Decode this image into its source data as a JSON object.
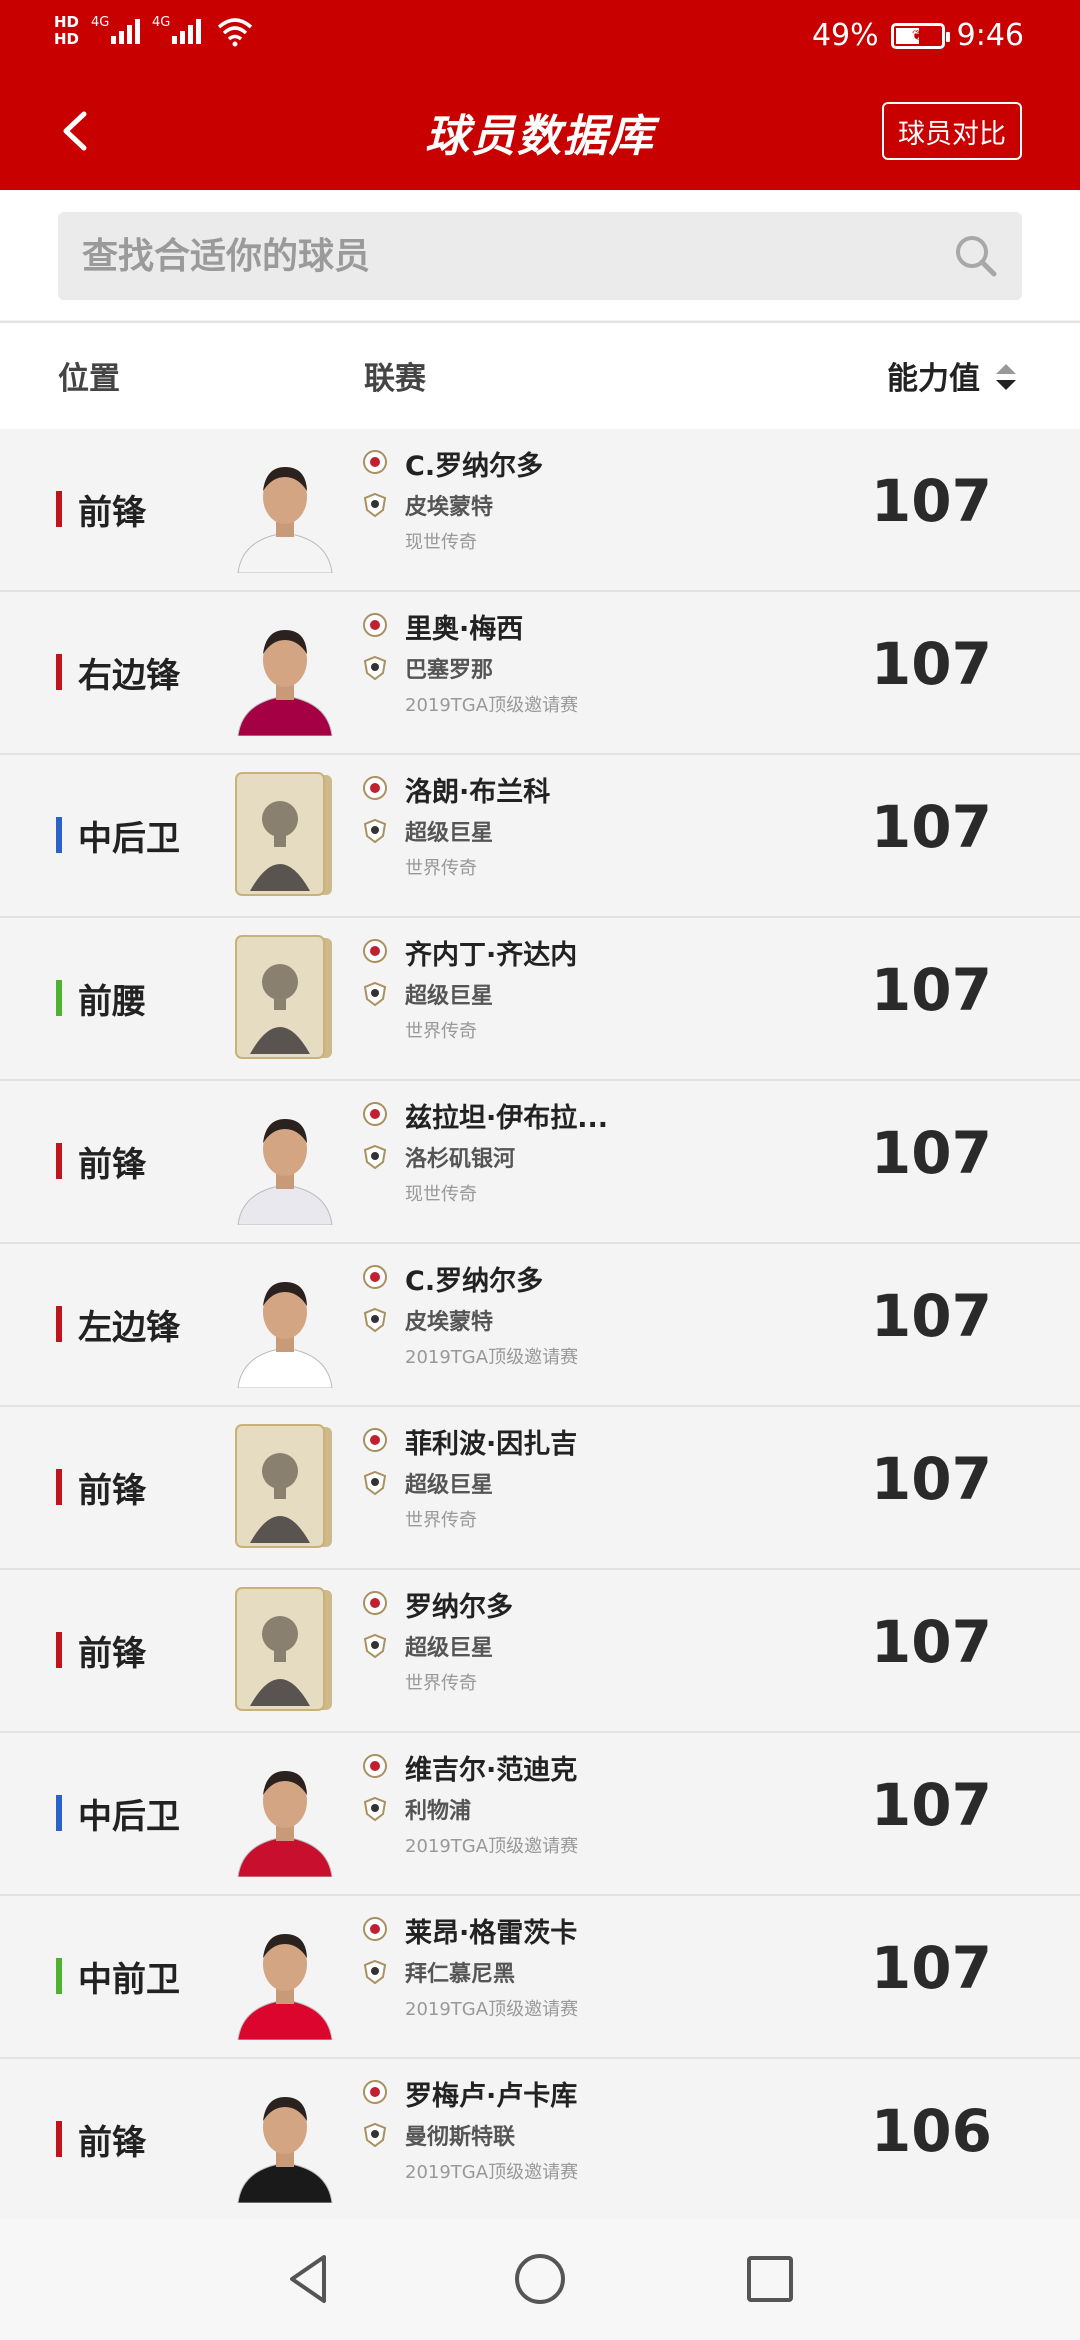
{
  "status_bar": {
    "hd1": "HD",
    "hd2": "HD",
    "net1": "4G",
    "net2": "4G",
    "battery": "49%",
    "time": "9:46"
  },
  "header": {
    "title": "球员数据库",
    "compare_label": "球员对比",
    "back_icon": "chevron-left-icon"
  },
  "search": {
    "placeholder": "查找合适你的球员",
    "value": ""
  },
  "columns": {
    "position": "位置",
    "league": "联赛",
    "rating": "能力值"
  },
  "colors": {
    "brand": "#c80000",
    "forward": "#c0141c",
    "defender": "#2a62c9",
    "midfielder": "#4db32e"
  },
  "players": [
    {
      "position": "前锋",
      "pos_type": "forward",
      "name": "C.罗纳尔多",
      "club": "皮埃蒙特",
      "event": "现世传奇",
      "rating": "107",
      "style": "photo",
      "shirt": "#f4f4f4",
      "league_icon": "serie-a-icon",
      "club_icon": "piemonte-icon"
    },
    {
      "position": "右边锋",
      "pos_type": "forward",
      "name": "里奥·梅西",
      "club": "巴塞罗那",
      "event": "2019TGA顶级邀请赛",
      "rating": "107",
      "style": "photo",
      "shirt": "#a50044",
      "league_icon": "laliga-icon",
      "club_icon": "barcelona-icon"
    },
    {
      "position": "中后卫",
      "pos_type": "defender",
      "name": "洛朗·布兰科",
      "club": "超级巨星",
      "event": "世界传奇",
      "rating": "107",
      "style": "card",
      "shirt": "#d8c9a4",
      "league_icon": "icon-badge",
      "club_icon": "icon-badge"
    },
    {
      "position": "前腰",
      "pos_type": "midfielder",
      "name": "齐内丁·齐达内",
      "club": "超级巨星",
      "event": "世界传奇",
      "rating": "107",
      "style": "card",
      "shirt": "#d8c9a4",
      "league_icon": "icon-badge",
      "club_icon": "icon-badge"
    },
    {
      "position": "前锋",
      "pos_type": "forward",
      "name": "兹拉坦·伊布拉...",
      "club": "洛杉矶银河",
      "event": "现世传奇",
      "rating": "107",
      "style": "photo",
      "shirt": "#e8e8ee",
      "league_icon": "mls-icon",
      "club_icon": "la-galaxy-icon"
    },
    {
      "position": "左边锋",
      "pos_type": "forward",
      "name": "C.罗纳尔多",
      "club": "皮埃蒙特",
      "event": "2019TGA顶级邀请赛",
      "rating": "107",
      "style": "photo",
      "shirt": "#ffffff",
      "league_icon": "serie-a-icon",
      "club_icon": "piemonte-icon"
    },
    {
      "position": "前锋",
      "pos_type": "forward",
      "name": "菲利波·因扎吉",
      "club": "超级巨星",
      "event": "世界传奇",
      "rating": "107",
      "style": "card",
      "shirt": "#d8c9a4",
      "league_icon": "icon-badge",
      "club_icon": "icon-badge"
    },
    {
      "position": "前锋",
      "pos_type": "forward",
      "name": "罗纳尔多",
      "club": "超级巨星",
      "event": "世界传奇",
      "rating": "107",
      "style": "card",
      "shirt": "#d8c9a4",
      "league_icon": "icon-badge",
      "club_icon": "icon-badge"
    },
    {
      "position": "中后卫",
      "pos_type": "defender",
      "name": "维吉尔·范迪克",
      "club": "利物浦",
      "event": "2019TGA顶级邀请赛",
      "rating": "107",
      "style": "photo",
      "shirt": "#c8102e",
      "league_icon": "premier-league-icon",
      "club_icon": "liverpool-icon"
    },
    {
      "position": "中前卫",
      "pos_type": "midfielder",
      "name": "莱昂·格雷茨卡",
      "club": "拜仁慕尼黑",
      "event": "2019TGA顶级邀请赛",
      "rating": "107",
      "style": "photo",
      "shirt": "#dc052d",
      "league_icon": "bundesliga-icon",
      "club_icon": "bayern-icon"
    },
    {
      "position": "前锋",
      "pos_type": "forward",
      "name": "罗梅卢·卢卡库",
      "club": "曼彻斯特联",
      "event": "2019TGA顶级邀请赛",
      "rating": "106",
      "style": "photo",
      "shirt": "#1a1a1a",
      "league_icon": "premier-league-icon",
      "club_icon": "man-utd-icon"
    }
  ],
  "nav": {
    "back_icon": "triangle-back-icon",
    "home_icon": "circle-home-icon",
    "recent_icon": "square-recent-icon"
  }
}
